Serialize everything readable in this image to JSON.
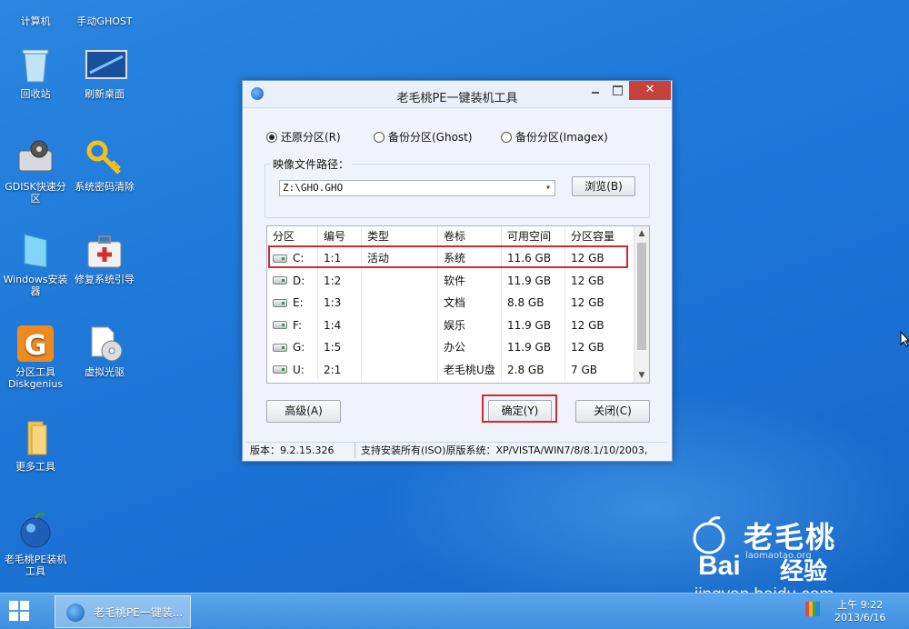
{
  "desktop": {
    "icons": [
      {
        "label": "计算机",
        "icon": "computer-icon"
      },
      {
        "label": "手动GHOST",
        "icon": "ghost-icon"
      },
      {
        "label": "回收站",
        "icon": "recycle-bin-icon"
      },
      {
        "label": "刷新桌面",
        "icon": "refresh-desktop-icon"
      },
      {
        "label": "GDISK快速分区",
        "icon": "gdisk-icon"
      },
      {
        "label": "系统密码清除",
        "icon": "key-icon"
      },
      {
        "label": "Windows安装器",
        "icon": "windows-installer-icon"
      },
      {
        "label": "修复系统引导",
        "icon": "first-aid-kit-icon"
      },
      {
        "label": "分区工具Diskgenius",
        "icon": "diskgenius-icon"
      },
      {
        "label": "虚拟光驱",
        "icon": "virtual-drive-icon"
      },
      {
        "label": "更多工具",
        "icon": "folder-icon"
      },
      {
        "label": "老毛桃PE装机工具",
        "icon": "laomaotao-icon"
      }
    ]
  },
  "window": {
    "title": "老毛桃PE一键装机工具",
    "close_symbol": "✕",
    "radio_options": [
      {
        "label": "还原分区(R)",
        "selected": true
      },
      {
        "label": "备份分区(Ghost)",
        "selected": false
      },
      {
        "label": "备份分区(Imagex)",
        "selected": false
      }
    ],
    "image_path_label": "映像文件路径：",
    "image_path_value": "Z:\\GHO.GHO",
    "browse_label": "浏览(B)",
    "table": {
      "headers": [
        "分区",
        "编号",
        "类型",
        "卷标",
        "可用空间",
        "分区容量"
      ],
      "rows": [
        {
          "part": "C:",
          "num": "1:1",
          "type": "活动",
          "label": "系统",
          "free": "11.6 GB",
          "cap": "12 GB",
          "highlighted": true
        },
        {
          "part": "D:",
          "num": "1:2",
          "type": "",
          "label": "软件",
          "free": "11.9 GB",
          "cap": "12 GB"
        },
        {
          "part": "E:",
          "num": "1:3",
          "type": "",
          "label": "文档",
          "free": "8.8 GB",
          "cap": "12 GB"
        },
        {
          "part": "F:",
          "num": "1:4",
          "type": "",
          "label": "娱乐",
          "free": "11.9 GB",
          "cap": "12 GB"
        },
        {
          "part": "G:",
          "num": "1:5",
          "type": "",
          "label": "办公",
          "free": "11.9 GB",
          "cap": "12 GB"
        },
        {
          "part": "U:",
          "num": "2:1",
          "type": "",
          "label": "老毛桃U盘",
          "free": "2.8 GB",
          "cap": "7 GB"
        }
      ]
    },
    "advanced_label": "高级(A)",
    "confirm_label": "确定(Y)",
    "close_label": "关闭(C)",
    "status_version": "版本：9.2.15.326",
    "status_support": "支持安装所有(ISO)原版系统：XP/VISTA/WIN7/8/8.1/10/2003,"
  },
  "taskbar": {
    "task_label": "老毛桃PE一键装...",
    "clock_time": "上午 9:22",
    "clock_date": "2013/6/16"
  },
  "watermark": {
    "brand": "老毛桃",
    "url_small": "laomaotao.org",
    "baidu": "Bai",
    "jingyan": "经验",
    "url": "jingyan.baidu.com"
  },
  "colors": {
    "desktop_blue": "#1e78d8",
    "close_red": "#c7423a",
    "highlight_red": "#d02a32"
  }
}
